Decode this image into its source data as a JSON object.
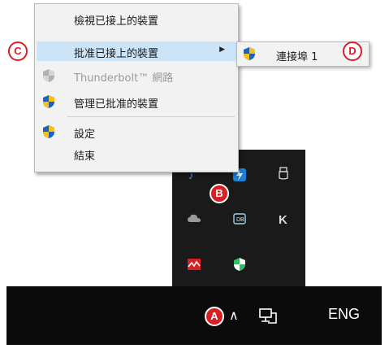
{
  "menu": {
    "items": [
      {
        "label": "檢視已接上的裝置",
        "icon": "",
        "disabled": false
      },
      {
        "label": "批准已接上的裝置",
        "icon": "",
        "disabled": false,
        "has_submenu": true
      },
      {
        "label": "Thunderbolt™ 網路",
        "icon": "gray-shield-icon",
        "disabled": true
      },
      {
        "label": "管理已批准的裝置",
        "icon": "uac-shield-icon",
        "disabled": false
      },
      {
        "label": "設定",
        "icon": "uac-shield-icon",
        "disabled": false
      },
      {
        "label": "結束",
        "icon": "",
        "disabled": false
      }
    ]
  },
  "submenu": {
    "label": "連接埠 1",
    "icon": "uac-shield-icon"
  },
  "markers": {
    "a": "A",
    "b": "B",
    "c": "C",
    "d": "D"
  },
  "taskbar": {
    "language": "ENG",
    "overflow_icon": "chevron-up-icon",
    "network_icon": "network-icon"
  },
  "colors": {
    "highlight": "#cce4f7",
    "marker": "#d81f26",
    "taskbar": "#0b0b0b"
  }
}
